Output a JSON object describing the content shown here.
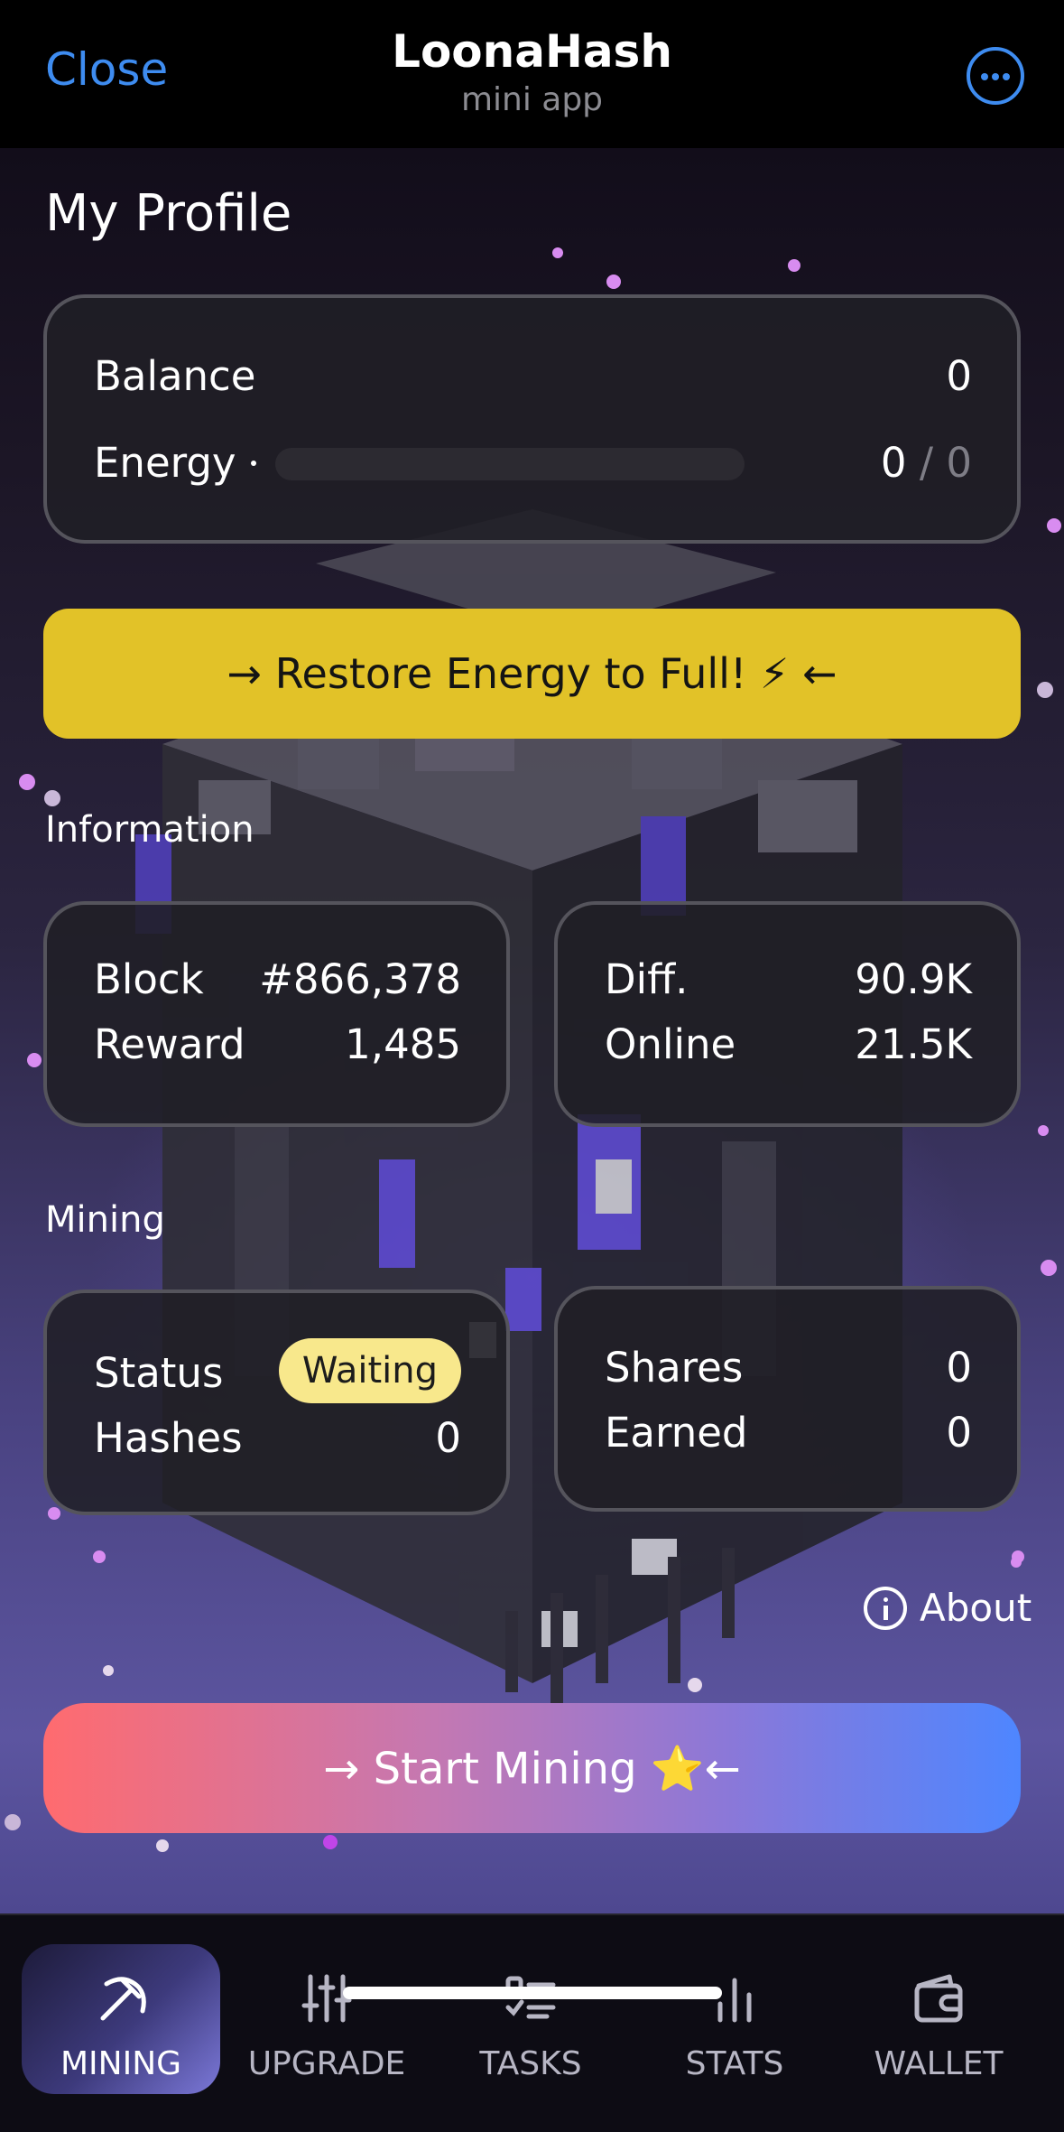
{
  "header": {
    "close_label": "Close",
    "title": "LoonaHash",
    "subtitle": "mini app",
    "more_icon": "ellipsis-circle-icon"
  },
  "profile": {
    "title": "My Profile",
    "balance_label": "Balance",
    "balance_value": "0",
    "energy_label": "Energy",
    "energy_current": "0",
    "energy_separator": "/",
    "energy_max": "0",
    "energy_fill": 0
  },
  "restore_button": {
    "label": "→ Restore Energy to Full! ⚡ ←"
  },
  "information": {
    "section_label": "Information",
    "block_label": "Block",
    "block_value": "#866,378",
    "reward_label": "Reward",
    "reward_value": "1,485",
    "diff_label": "Diff.",
    "diff_value": "90.9K",
    "online_label": "Online",
    "online_value": "21.5K"
  },
  "mining": {
    "section_label": "Mining",
    "status_label": "Status",
    "status_value": "Waiting",
    "hashes_label": "Hashes",
    "hashes_value": "0",
    "shares_label": "Shares",
    "shares_value": "0",
    "earned_label": "Earned",
    "earned_value": "0"
  },
  "about": {
    "label": "About",
    "icon": "info-circle-icon"
  },
  "start_button": {
    "label": "→ Start Mining ⭐←"
  },
  "nav": {
    "items": [
      {
        "label": "MINING",
        "icon": "pickaxe-icon",
        "active": true
      },
      {
        "label": "UPGRADE",
        "icon": "sliders-icon",
        "active": false
      },
      {
        "label": "TASKS",
        "icon": "checklist-icon",
        "active": false
      },
      {
        "label": "STATS",
        "icon": "bar-chart-icon",
        "active": false
      },
      {
        "label": "WALLET",
        "icon": "wallet-icon",
        "active": false
      }
    ]
  },
  "colors": {
    "accent_blue": "#3e8cf0",
    "restore_yellow": "#e2c228",
    "badge_yellow": "#f8e88c",
    "start_gradient_start": "#ff6b6f",
    "start_gradient_end": "#4e86ff",
    "card_bg": "#201f26",
    "card_border": "#55545c"
  }
}
